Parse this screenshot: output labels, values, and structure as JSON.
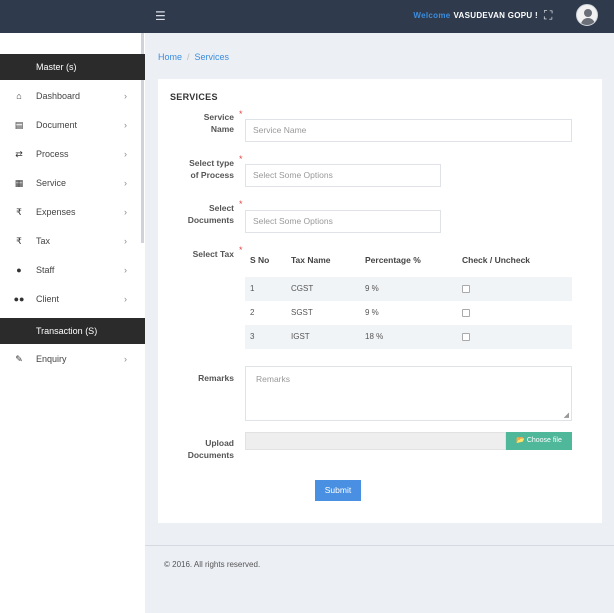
{
  "topbar": {
    "menu_icon": "hamburger-icon",
    "welcome_label": "Welcome",
    "user_name": "VASUDEVAN GOPU !",
    "fullscreen_icon": "expand-icon",
    "avatar_icon": "user-avatar-icon"
  },
  "sidebar": {
    "master_header": "Master (s)",
    "items": [
      {
        "label": "Dashboard",
        "icon": "home-icon"
      },
      {
        "label": "Document",
        "icon": "document-icon"
      },
      {
        "label": "Process",
        "icon": "shuffle-icon"
      },
      {
        "label": "Service",
        "icon": "grid-icon"
      },
      {
        "label": "Expenses",
        "icon": "rupee-icon"
      },
      {
        "label": "Tax",
        "icon": "rupee-icon"
      },
      {
        "label": "Staff",
        "icon": "user-icon"
      },
      {
        "label": "Client",
        "icon": "users-icon"
      }
    ],
    "transaction_header": "Transaction (S)",
    "enquiry": {
      "label": "Enquiry",
      "icon": "edit-icon"
    }
  },
  "breadcrumb": {
    "home": "Home",
    "separator": "/",
    "current": "Services"
  },
  "form": {
    "title": "SERVICES",
    "service_name": {
      "label_line1": "Service",
      "label_line2": "Name",
      "placeholder": "Service Name",
      "value": ""
    },
    "process_type": {
      "label_line1": "Select type",
      "label_line2": "of Process",
      "placeholder": "Select Some Options"
    },
    "documents": {
      "label_line1": "Select",
      "label_line2": "Documents",
      "placeholder": "Select Some Options"
    },
    "tax": {
      "label": "Select Tax",
      "headers": [
        "S No",
        "Tax Name",
        "Percentage %",
        "Check / Uncheck"
      ],
      "rows": [
        {
          "sno": "1",
          "name": "CGST",
          "percent": "9 %",
          "checked": false
        },
        {
          "sno": "2",
          "name": "SGST",
          "percent": "9 %",
          "checked": false
        },
        {
          "sno": "3",
          "name": "IGST",
          "percent": "18 %",
          "checked": false
        }
      ]
    },
    "remarks": {
      "label": "Remarks",
      "placeholder": "Remarks"
    },
    "upload": {
      "label_line1": "Upload",
      "label_line2": "Documents",
      "button": "Choose file",
      "button_icon": "folder-open-icon"
    },
    "submit_label": "Submit",
    "required_mark": "*"
  },
  "footer": {
    "text": "© 2016. All rights reserved."
  },
  "colors": {
    "topbar": "#2f3a4c",
    "accent": "#3c8dde",
    "success": "#4fb79a",
    "submit": "#4a90e2",
    "sidebar_header": "#2b2b2b",
    "required": "#e04848"
  }
}
